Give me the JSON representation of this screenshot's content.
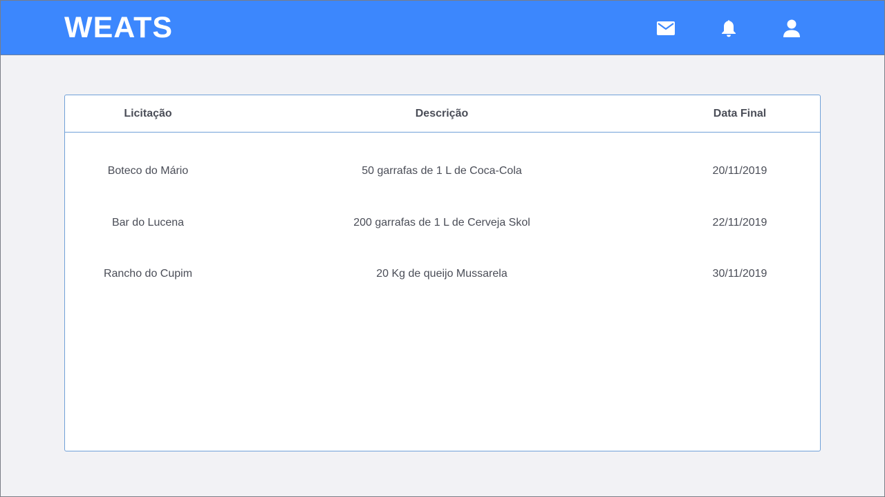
{
  "header": {
    "logo": "WEATS",
    "background": "#3c87fd",
    "icons": [
      "mail-icon",
      "bell-icon",
      "user-icon"
    ]
  },
  "table": {
    "columns": [
      "Licitação",
      "Descrição",
      "Data Final"
    ],
    "rows": [
      {
        "licitacao": "Boteco do Mário",
        "descricao": "50 garrafas de 1 L de Coca-Cola",
        "data_final": "20/11/2019"
      },
      {
        "licitacao": "Bar do Lucena",
        "descricao": "200 garrafas de 1 L de Cerveja Skol",
        "data_final": "22/11/2019"
      },
      {
        "licitacao": "Rancho do Cupim",
        "descricao": "20 Kg de queijo Mussarela",
        "data_final": "30/11/2019"
      }
    ]
  }
}
